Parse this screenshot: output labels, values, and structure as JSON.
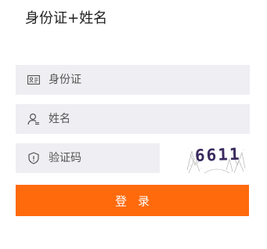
{
  "form": {
    "title": "身份证+姓名",
    "id_field": {
      "placeholder": "身份证",
      "value": "",
      "icon": "id-card-icon"
    },
    "name_field": {
      "placeholder": "姓名",
      "value": "",
      "icon": "user-icon"
    },
    "code_field": {
      "placeholder": "验证码",
      "value": "",
      "icon": "shield-icon"
    },
    "captcha": {
      "text": "6611"
    },
    "login_label": "登录"
  },
  "colors": {
    "field_background": "#efeef3",
    "accent": "#ff6a0c",
    "button_text": "#ffffff",
    "captcha_text": "#3a2a5e"
  }
}
